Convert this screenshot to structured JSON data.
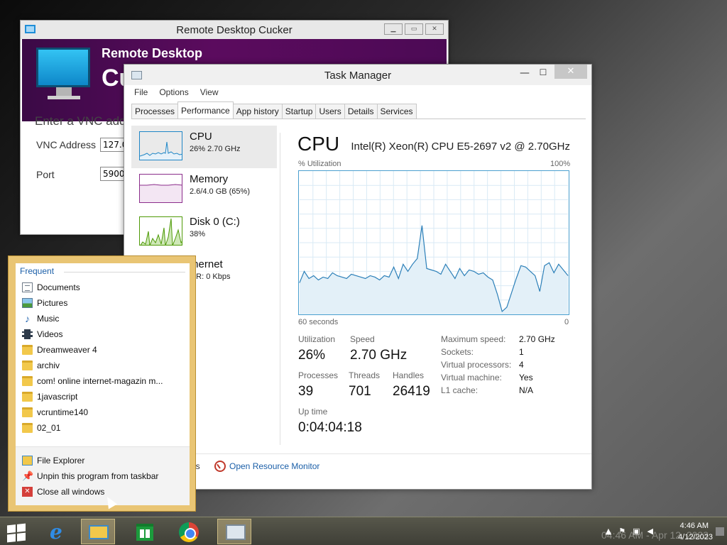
{
  "remote_desktop": {
    "window_title": "Remote Desktop Cucker",
    "banner_title": "Remote Desktop",
    "banner_big": "Cu",
    "enter_prompt": "Enter a VNC add",
    "vnc_label": "VNC Address",
    "vnc_value": "127.0.",
    "port_label": "Port",
    "port_value": "5900",
    "icon": "monitor-icon"
  },
  "task_manager": {
    "title": "Task Manager",
    "menu": [
      "File",
      "Options",
      "View"
    ],
    "tabs": [
      "Processes",
      "Performance",
      "App history",
      "Startup",
      "Users",
      "Details",
      "Services"
    ],
    "active_tab": "Performance",
    "sidebar": [
      {
        "name": "CPU",
        "sub": "26% 2.70 GHz",
        "color": "#1f86c6"
      },
      {
        "name": "Memory",
        "sub": "2.6/4.0 GB (65%)",
        "color": "#8b2d8b"
      },
      {
        "name": "Disk 0 (C:)",
        "sub": "38%",
        "color": "#4e9a06"
      },
      {
        "name": "thernet",
        "sub": "0 R: 0 Kbps",
        "color": "#a0522d"
      }
    ],
    "cpu": {
      "heading": "CPU",
      "model": "Intel(R) Xeon(R) CPU E5-2697 v2 @ 2.70GHz",
      "util_label": "% Utilization",
      "max_label": "100%",
      "time_label": "60 seconds",
      "zero_label": "0",
      "stats": {
        "utilization_label": "Utilization",
        "utilization": "26%",
        "speed_label": "Speed",
        "speed": "2.70 GHz",
        "processes_label": "Processes",
        "processes": "39",
        "threads_label": "Threads",
        "threads": "701",
        "handles_label": "Handles",
        "handles": "26419",
        "uptime_label": "Up time",
        "uptime": "0:04:04:18"
      },
      "details": [
        {
          "label": "Maximum speed:",
          "value": "2.70 GHz"
        },
        {
          "label": "Sockets:",
          "value": "1"
        },
        {
          "label": "Virtual processors:",
          "value": "4"
        },
        {
          "label": "Virtual machine:",
          "value": "Yes"
        },
        {
          "label": "L1 cache:",
          "value": "N/A"
        }
      ],
      "graph_values": [
        22,
        30,
        25,
        27,
        24,
        26,
        25,
        29,
        27,
        26,
        25,
        28,
        27,
        26,
        25,
        27,
        26,
        24,
        27,
        26,
        33,
        25,
        35,
        30,
        35,
        39,
        62,
        32,
        31,
        30,
        28,
        35,
        30,
        25,
        32,
        27,
        31,
        30,
        28,
        29,
        26,
        24,
        14,
        2,
        5,
        15,
        25,
        34,
        33,
        30,
        27,
        16,
        34,
        36,
        29,
        35,
        31,
        27
      ]
    },
    "footer": {
      "fewer_details": "ls",
      "open_resource_monitor": "Open Resource Monitor"
    }
  },
  "jump_list": {
    "header": "Frequent",
    "items": [
      {
        "label": "Documents",
        "icon": "documents-icon"
      },
      {
        "label": "Pictures",
        "icon": "pictures-icon"
      },
      {
        "label": "Music",
        "icon": "music-icon"
      },
      {
        "label": "Videos",
        "icon": "videos-icon"
      },
      {
        "label": "Dreamweaver 4",
        "icon": "folder-icon"
      },
      {
        "label": "archiv",
        "icon": "folder-icon"
      },
      {
        "label": "com! online internet-magazin m...",
        "icon": "folder-icon"
      },
      {
        "label": "1javascript",
        "icon": "folder-icon"
      },
      {
        "label": "vcruntime140",
        "icon": "folder-icon"
      },
      {
        "label": "02_01",
        "icon": "folder-icon"
      }
    ],
    "tasks": [
      {
        "label": "File Explorer",
        "icon": "file-explorer-icon"
      },
      {
        "label": "Unpin this program from taskbar",
        "icon": "unpin-icon"
      },
      {
        "label": "Close all windows",
        "icon": "close-icon"
      }
    ]
  },
  "taskbar": {
    "apps": [
      "start-icon",
      "internet-explorer-icon",
      "file-explorer-icon",
      "store-icon",
      "chrome-icon",
      "task-manager-icon"
    ],
    "time": "4:46 AM",
    "date": "4/12/2023",
    "ghost_clock": "04:46 AM - Apr 12, 2023"
  }
}
